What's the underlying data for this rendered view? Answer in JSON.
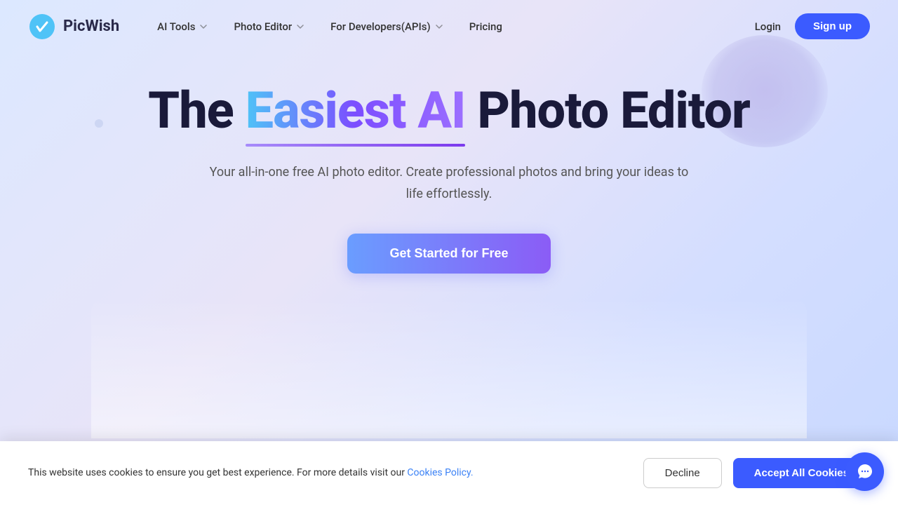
{
  "brand": {
    "name": "PicWish",
    "logo_alt": "PicWish Logo"
  },
  "nav": {
    "items": [
      {
        "label": "AI Tools",
        "has_dropdown": true
      },
      {
        "label": "Photo Editor",
        "has_dropdown": true
      },
      {
        "label": "For Developers(APIs)",
        "has_dropdown": true
      },
      {
        "label": "Pricing",
        "has_dropdown": false
      }
    ],
    "login_label": "Login",
    "signup_label": "Sign up"
  },
  "hero": {
    "heading_prefix": "The ",
    "heading_gradient": "Easiest AI",
    "heading_suffix": " Photo Editor",
    "subtext": "Your all-in-one free AI photo editor. Create professional photos and bring your ideas to life effortlessly.",
    "cta_label": "Get Started for Free"
  },
  "cookie": {
    "message": "This website uses cookies to ensure you get best experience. For more details visit our ",
    "link_text": "Cookies Policy.",
    "decline_label": "Decline",
    "accept_label": "Accept All Cookies"
  },
  "chat": {
    "icon_label": "chat-support-icon"
  }
}
